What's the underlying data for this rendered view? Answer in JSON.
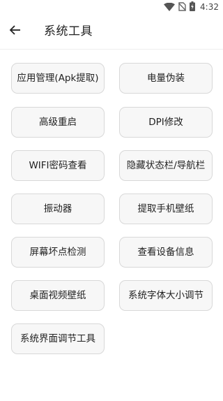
{
  "status_bar": {
    "time": "4:32",
    "icons": [
      "wifi-icon",
      "no-sim-icon",
      "battery-charging-icon"
    ]
  },
  "header": {
    "back_icon": "arrow-left-icon",
    "title": "系统工具"
  },
  "tools": [
    {
      "label": "应用管理(Apk提取)"
    },
    {
      "label": "电量伪装"
    },
    {
      "label": "高级重启"
    },
    {
      "label": "DPI修改"
    },
    {
      "label": "WIFI密码查看"
    },
    {
      "label": "隐藏状态栏/导航栏"
    },
    {
      "label": "振动器"
    },
    {
      "label": "提取手机壁纸"
    },
    {
      "label": "屏幕坏点检测"
    },
    {
      "label": "查看设备信息"
    },
    {
      "label": "桌面视频壁纸"
    },
    {
      "label": "系统字体大小调节"
    },
    {
      "label": "系统界面调节工具"
    }
  ]
}
